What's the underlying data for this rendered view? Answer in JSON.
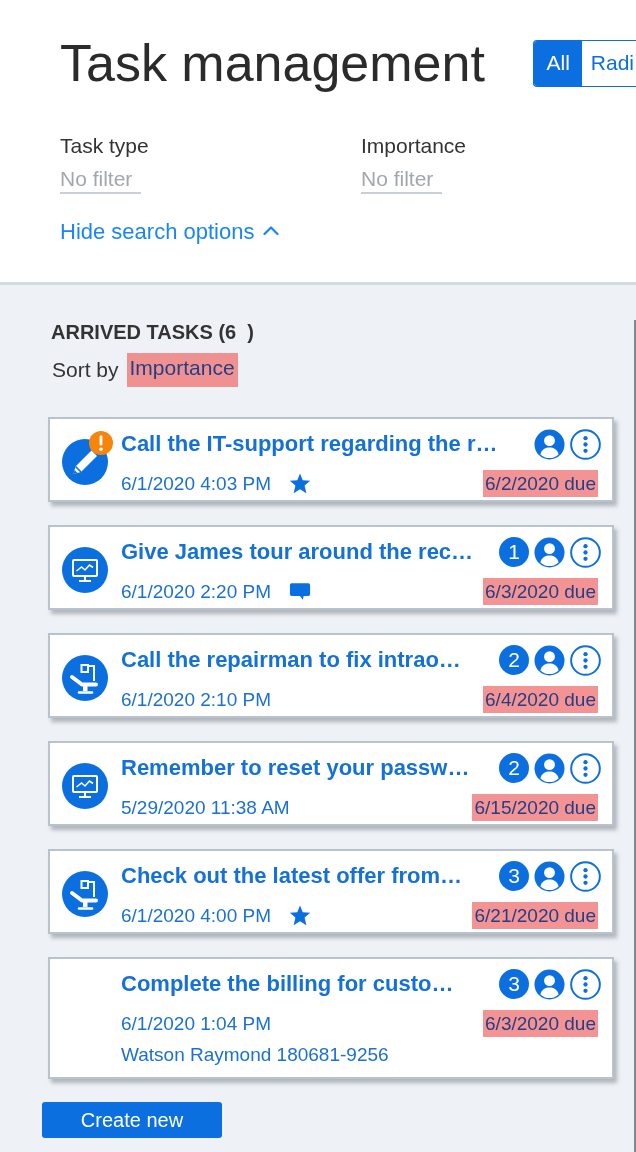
{
  "header": {
    "title": "Task management",
    "view_options": [
      {
        "label": "All",
        "selected": true
      },
      {
        "label": "Radi",
        "selected": false
      }
    ]
  },
  "filters": [
    {
      "label": "Task type",
      "placeholder": "No filter"
    },
    {
      "label": "Importance",
      "placeholder": "No filter"
    }
  ],
  "search_options_toggle": {
    "label": "Hide search options",
    "expanded": true
  },
  "task_list": {
    "heading": "ARRIVED TASKS (6  )",
    "sort_label": "Sort by",
    "sort_value": "Importance",
    "tasks": [
      {
        "kind": "note",
        "alert": true,
        "title": "Call the IT-support regarding the r…",
        "created": "6/1/2020 4:03 PM",
        "starred": true,
        "commented": false,
        "due": "6/2/2020 due"
      },
      {
        "kind": "monitor",
        "alert": false,
        "priority": "1",
        "title": "Give James tour around the rec…",
        "created": "6/1/2020 2:20 PM",
        "starred": false,
        "commented": true,
        "due": "6/3/2020 due"
      },
      {
        "kind": "dental",
        "alert": false,
        "priority": "2",
        "title": "Call the repairman to fix intrao…",
        "created": "6/1/2020 2:10 PM",
        "starred": false,
        "commented": false,
        "due": "6/4/2020 due"
      },
      {
        "kind": "monitor",
        "alert": false,
        "priority": "2",
        "title": "Remember to reset your passw…",
        "created": "5/29/2020 11:38 AM",
        "starred": false,
        "commented": false,
        "due": "6/15/2020 due"
      },
      {
        "kind": "dental",
        "alert": false,
        "priority": "3",
        "title": "Check out the latest offer from…",
        "created": "6/1/2020 4:00 PM",
        "starred": true,
        "commented": false,
        "due": "6/21/2020 due"
      },
      {
        "kind": "none",
        "alert": false,
        "priority": "3",
        "title": "Complete the billing for custo…",
        "created": "6/1/2020 1:04 PM",
        "starred": false,
        "commented": false,
        "due": "6/3/2020 due",
        "customer": "Watson Raymond 180681-9256"
      }
    ]
  },
  "create_button": {
    "label": "Create new"
  }
}
